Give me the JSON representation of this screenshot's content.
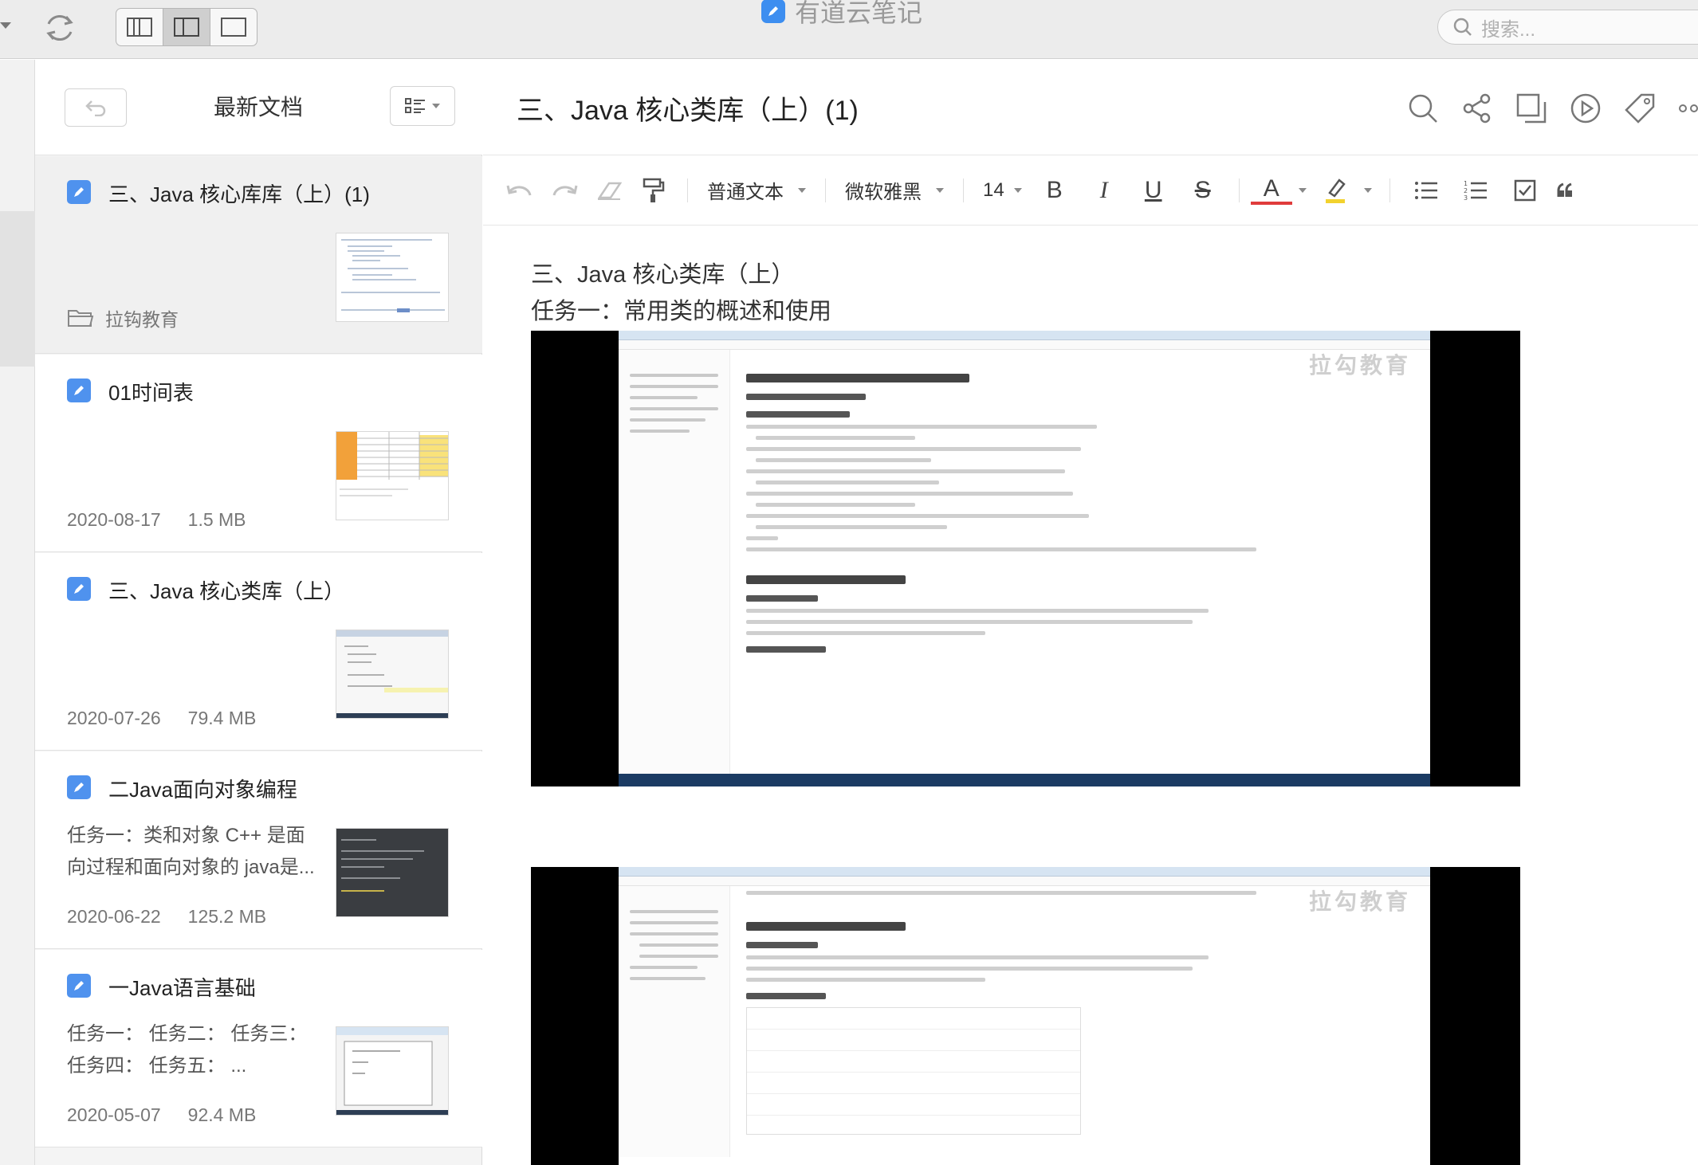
{
  "app": {
    "title": "有道云笔记"
  },
  "search": {
    "placeholder": "搜索..."
  },
  "list": {
    "title": "最新文档",
    "items": [
      {
        "title": "三、Java 核心库库（上）(1)",
        "folder": "拉钩教育",
        "snippet": "",
        "date": "",
        "size": ""
      },
      {
        "title": "01时间表",
        "folder": "",
        "snippet": "",
        "date": "2020-08-17",
        "size": "1.5 MB"
      },
      {
        "title": "三、Java 核心类库（上）",
        "folder": "",
        "snippet": "",
        "date": "2020-07-26",
        "size": "79.4 MB"
      },
      {
        "title": "二Java面向对象编程",
        "folder": "",
        "snippet": "任务一：类和对象 C++ 是面向过程和面向对象的 java是...",
        "date": "2020-06-22",
        "size": "125.2 MB"
      },
      {
        "title": "一Java语言基础",
        "folder": "",
        "snippet": "任务一： 任务二： 任务三： 任务四： 任务五： ...",
        "date": "2020-05-07",
        "size": "92.4 MB"
      }
    ]
  },
  "editor": {
    "title": "三、Java 核心类库（上）(1)",
    "toolbar": {
      "paragraph": "普通文本",
      "font": "微软雅黑",
      "size": "14",
      "bold": "B",
      "italic": "I",
      "underline": "U",
      "strike": "S",
      "color": "A"
    },
    "content": {
      "heading": "三、Java 核心类库（上）",
      "subheading": "任务一：常用类的概述和使用",
      "watermark": "拉勾教育"
    }
  },
  "colors": {
    "accent": "#3d8ef0",
    "doc_icon": "#4f92ee",
    "titlebar": "#ececec"
  }
}
